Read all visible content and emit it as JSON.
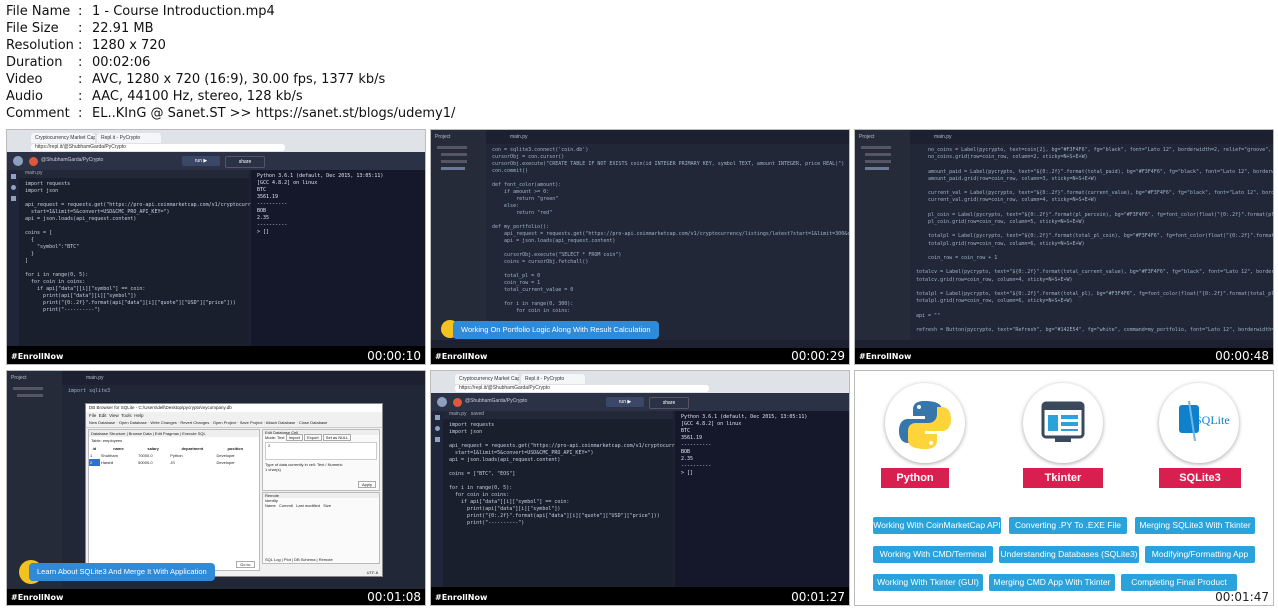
{
  "file_info": [
    {
      "key": "File Name",
      "value": "1 - Course Introduction.mp4"
    },
    {
      "key": "File Size",
      "value": "22.91 MB"
    },
    {
      "key": "Resolution",
      "value": "1280 x 720"
    },
    {
      "key": "Duration",
      "value": "00:02:06"
    },
    {
      "key": "Video",
      "value": "AVC, 1280 x 720 (16:9), 30.00 fps, 1377 kb/s"
    },
    {
      "key": "Audio",
      "value": "AAC, 44100 Hz, stereo, 128 kb/s"
    },
    {
      "key": "Comment",
      "value": "EL..KInG @ Sanet.ST >> https://sanet.st/blogs/udemy1/"
    }
  ],
  "separator": ":",
  "thumbnails": [
    {
      "label": "#EnrollNow",
      "timestamp": "00:00:10"
    },
    {
      "label": "#EnrollNow",
      "timestamp": "00:00:29"
    },
    {
      "label": "#EnrollNow",
      "timestamp": "00:00:48"
    },
    {
      "label": "#EnrollNow",
      "timestamp": "00:01:08"
    },
    {
      "label": "#EnrollNow",
      "timestamp": "00:01:27"
    },
    {
      "label": "",
      "timestamp": "00:01:47"
    }
  ],
  "thumb1": {
    "tab1": "Cryptocurrency Market Capitali",
    "tab2": "Repl.it - PyCrypto",
    "url": "https://repl.it/@ShubhamGarda/PyCrypto",
    "user": "@ShubhamGarda/PyCrypto",
    "file": "main.py",
    "run": "run ▶",
    "share": "share",
    "code": "import requests\nimport json\n\napi_request = requests.get(\"https://pro-api.coinmarketcap.com/v1/cryptocurrency/listings/latest?\n  start=1&limit=5&convert=USD&CMC_PRO_API_KEY=\")\napi = json.loads(api_request.content)\n\ncoins = [\n  {\n    \"symbol\":\"BTC\"\n  }\n]\n\nfor i in range(0, 5):\n  for coin in coins:\n    if api[\"data\"][i][\"symbol\"] == coin:\n      print(api[\"data\"][i][\"symbol\"])\n      print(\"{0:.2f}\".format(api[\"data\"][i][\"quote\"][\"USD\"][\"price\"]))\n      print(\"----------\")",
    "console": "Python 3.6.1 (default, Dec 2015, 13:05:11)\n[GCC 4.8.2] on linux\nBTC\n3561.19\n----------\nBOB\n2.35\n----------\n> []"
  },
  "thumb2": {
    "project": "Project",
    "file": "main.py",
    "banner": "Working On Portfolio Logic Along With Result Calculation",
    "code": "con = sqlite3.connect('coin.db')\ncursorObj = con.cursor()\ncursorObj.execute(\"CREATE TABLE IF NOT EXISTS coin(id INTEGER PRIMARY KEY, symbol TEXT, amount INTEGER, price REAL)\")\ncon.commit()\n\ndef font_color(amount):\n    if amount >= 0:\n        return \"green\"\n    else:\n        return \"red\"\n\ndef my_portfolio():\n    api_request = requests.get(\"https://pro-api.coinmarketcap.com/v1/cryptocurrency/listings/latest?start=1&limit=300&convert=USD\")\n    api = json.loads(api_request.content)\n\n    cursorObj.execute(\"SELECT * FROM coin\")\n    coins = cursorObj.fetchall()\n\n    total_pl = 0\n    coin_row = 1\n    total_current_value = 0\n\n    for i in range(0, 300):\n        for coin in coins:"
  },
  "thumb3": {
    "project": "Project",
    "file": "main.py",
    "code": "    no_coins = Label(pycrypto, text=coin[2], bg=\"#F3F4F6\", fg=\"black\", font=\"Lato 12\", borderwidth=2, relief=\"groove\", padx=\"5\")\n    no_coins.grid(row=coin_row, column=2, sticky=N+S+E+W)\n\n    amount_paid = Label(pycrypto, text=\"${0:.2f}\".format(total_paid), bg=\"#F3F4F6\", fg=\"black\", font=\"Lato 12\", borderwidth=2)\n    amount_paid.grid(row=coin_row, column=3, sticky=N+S+E+W)\n\n    current_val = Label(pycrypto, text=\"${0:.2f}\".format(current_value), bg=\"#F3F4F6\", fg=\"black\", font=\"Lato 12\", borderwidth=2)\n    current_val.grid(row=coin_row, column=4, sticky=N+S+E+W)\n\n    pl_coin = Label(pycrypto, text=\"${0:.2f}\".format(pl_percoin), bg=\"#F3F4F6\", fg=font_color(float(\"{0:.2f}\".format(pl_percoin))))\n    pl_coin.grid(row=coin_row, column=5, sticky=N+S+E+W)\n\n    totalpl = Label(pycrypto, text=\"${0:.2f}\".format(total_pl_coin), bg=\"#F3F4F6\", fg=font_color(float(\"{0:.2f}\".format(total_pl_coin))))\n    totalpl.grid(row=coin_row, column=6, sticky=N+S+E+W)\n\n    coin_row = coin_row + 1\n\ntotalcv = Label(pycrypto, text=\"${0:.2f}\".format(total_current_value), bg=\"#F3F4F6\", fg=\"black\", font=\"Lato 12\", borderwidth=2)\ntotalcv.grid(row=coin_row, column=4, sticky=N+S+E+W)\n\ntotalpl = Label(pycrypto, text=\"${0:.2f}\".format(total_pl), bg=\"#F3F4F6\", fg=font_color(float(\"{0:.2f}\".format(total_pl))))\ntotalpl.grid(row=coin_row, column=6, sticky=N+S+E+W)\n\napi = \"\"\n\nrefresh = Button(pycrypto, text=\"Refresh\", bg=\"#142E54\", fg=\"white\", command=my_portfolio, font=\"Lato 12\", borderwidth=2, relief=\"groove\")"
  },
  "thumb4": {
    "project": "Project",
    "file": "main.py",
    "code_top": "import sqlite3",
    "dialog_title": "DB Browser for SQLite - C:\\Users\\dell\\Desktop\\pycrypto\\mycompany.db",
    "menu": [
      "File",
      "Edit",
      "View",
      "Tools",
      "Help"
    ],
    "toolbar": [
      "New Database",
      "Open Database",
      "Write Changes",
      "Revert Changes",
      "Open Project",
      "Save Project",
      "Attach Database",
      "Close Database"
    ],
    "tabs": [
      "Database Structure",
      "Browse Data",
      "Edit Pragmas",
      "Execute SQL"
    ],
    "table_label": "Table:",
    "table_value": "employees",
    "columns": [
      "id",
      "name",
      "salary",
      "department",
      "position"
    ],
    "rows": [
      [
        "1",
        "Shubham",
        "70000.0",
        "Python",
        "Developer"
      ],
      [
        "2",
        "Harshil",
        "50000.0",
        "JS",
        "Developer"
      ]
    ],
    "edit_cell_title": "Edit Database Cell",
    "mode_label": "Mode:",
    "mode_value": "Text",
    "import_btn": "Import",
    "export_btn": "Export",
    "setnull_btn": "Set as NULL",
    "cell_value": "2",
    "cell_info": "Type of data currently in cell: Text / Numeric\n1 char(s)",
    "apply_btn": "Apply",
    "remote_title": "Remote",
    "identity_label": "Identity",
    "remote_cols": [
      "Name",
      "Commit",
      "Last modified",
      "Size"
    ],
    "bottom_tabs": [
      "SQL Log",
      "Plot",
      "DB Schema",
      "Remote"
    ],
    "encoding": "UTF-8",
    "goto_btn": "Go to:",
    "pager": "1 - 2 of 2",
    "banner": "Learn About SQLite3 And Merge It With Application"
  },
  "thumb5": {
    "tab1": "Cryptocurrency Market Capitali",
    "tab2": "Repl.it - PyCrypto",
    "url": "https://repl.it/@ShubhamGarda/PyCrypto",
    "user": "@ShubhamGarda/PyCrypto",
    "file": "main.py",
    "saved": "saved",
    "run": "run ▶",
    "share": "share",
    "code": "import requests\nimport json\n\napi_request = requests.get(\"https://pro-api.coinmarketcap.com/v1/cryptocurrency/listings/latest?\n  start=1&limit=5&convert=USD&CMC_PRO_API_KEY=\")\napi = json.loads(api_request.content)\n\ncoins = [\"BTC\", \"EOS\"]\n\nfor i in range(0, 5):\n  for coin in coins:\n    if api[\"data\"][i][\"symbol\"] == coin:\n      print(api[\"data\"][i][\"symbol\"])\n      print(\"{0:.2f}\".format(api[\"data\"][i][\"quote\"][\"USD\"][\"price\"]))\n      print(\"----------\")",
    "console": "Python 3.6.1 (default, Dec 2015, 13:05:11)\n[GCC 4.8.2] on linux\nBTC\n3561.19\n----------\nBOB\n2.35\n----------\n> []"
  },
  "thumb6": {
    "badges": [
      "Python",
      "Tkinter",
      "SQLite3"
    ],
    "sqlite_logo_text": "SQLite",
    "features": [
      "Working With CoinMarketCap API",
      "Converting .PY To .EXE File",
      "Merging SQLite3 With Tkinter",
      "Working With CMD/Terminal",
      "Understanding Databases (SQLite3)",
      "Modifying/Formatting App",
      "Working With Tkinter (GUI)",
      "Merging CMD App With Tkinter",
      "Completing Final Product"
    ]
  },
  "colors": {
    "banner_blue": "#2f8ad8",
    "badge_red": "#d81f4f",
    "feature_blue": "#2aa3dd",
    "dark_bg": "#1d2230",
    "python_blue": "#3776ab",
    "python_yellow": "#ffd43b",
    "sqlite_blue": "#0f80cc"
  }
}
